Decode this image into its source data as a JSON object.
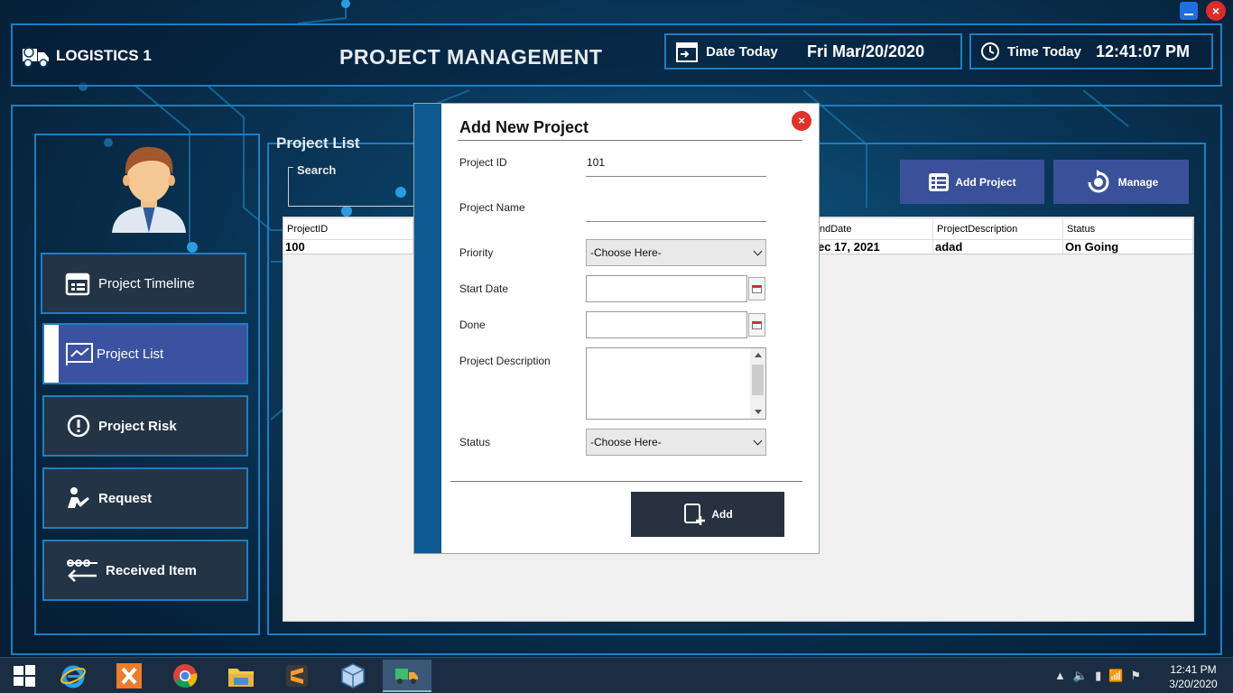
{
  "window": {
    "minimize_icon": "minimize-icon",
    "close_icon": "close-x-icon",
    "close_label": "×"
  },
  "header": {
    "logo_text": "LOGISTICS 1",
    "title": "PROJECT MANAGEMENT",
    "date_label": "Date Today",
    "date_value": "Fri Mar/20/2020",
    "time_label": "Time Today",
    "time_value": "12:41:07 PM"
  },
  "sidebar": {
    "items": [
      {
        "label": "Project Timeline",
        "icon": "calendar-icon"
      },
      {
        "label": "Project List",
        "icon": "chart-board-icon"
      },
      {
        "label": "Project Risk",
        "icon": "exclamation-icon"
      },
      {
        "label": "Request",
        "icon": "person-request-icon"
      },
      {
        "label": "Received Item",
        "icon": "received-arrow-icon"
      }
    ]
  },
  "content": {
    "section_title": "Project List",
    "search_label": "Search",
    "add_project_label": "Add Project",
    "manage_label": "Manage",
    "table": {
      "columns": [
        "ProjectID",
        "ndDate",
        "ProjectDescription",
        "Status"
      ],
      "rows": [
        [
          "100",
          "ec 17, 2021",
          "adad",
          "On Going"
        ]
      ]
    }
  },
  "modal": {
    "title": "Add New Project",
    "close_label": "×",
    "fields": {
      "project_id_label": "Project ID",
      "project_id_value": "101",
      "project_name_label": "Project Name",
      "priority_label": "Priority",
      "priority_value": "-Choose Here-",
      "start_date_label": "Start Date",
      "done_label": "Done",
      "description_label": "Project Description",
      "status_label": "Status",
      "status_value": "-Choose Here-"
    },
    "add_label": "Add"
  },
  "taskbar": {
    "clock_time": "12:41 PM",
    "clock_date": "3/20/2020"
  },
  "colors": {
    "accent": "#1b7fc0",
    "nav_active": "#3a52a0",
    "nav_bg": "#243447",
    "modal_stripe": "#0f5a91"
  }
}
